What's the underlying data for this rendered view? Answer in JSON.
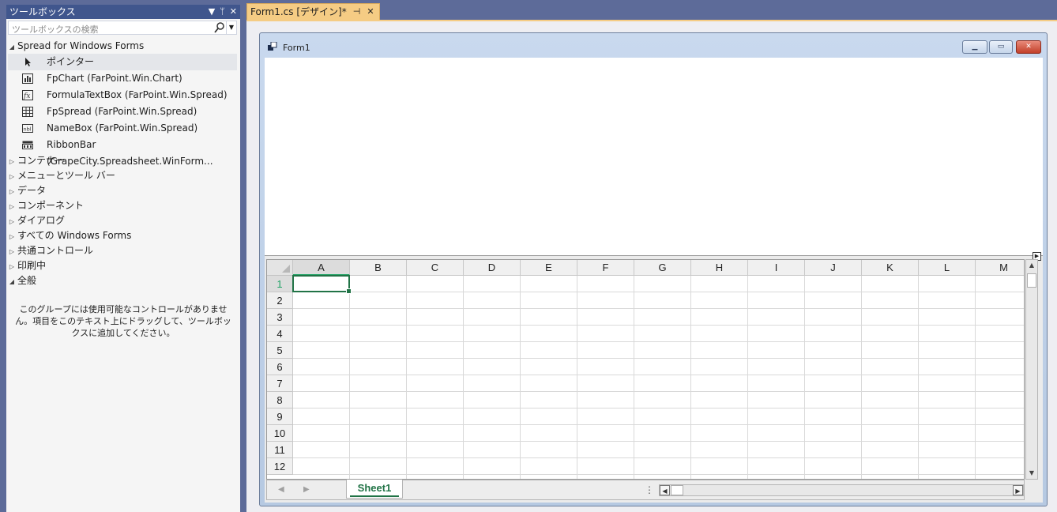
{
  "toolbox": {
    "title": "ツールボックス",
    "buttons": {
      "dropdown": "▼",
      "pin": "ᛘ",
      "close": "✕"
    },
    "search_placeholder": "ツールボックスの検索",
    "groups": [
      {
        "label": "Spread for Windows Forms",
        "expanded": true
      },
      {
        "label": "コンテナー",
        "expanded": false
      },
      {
        "label": "メニューとツール バー",
        "expanded": false
      },
      {
        "label": "データ",
        "expanded": false
      },
      {
        "label": "コンポーネント",
        "expanded": false
      },
      {
        "label": "ダイアログ",
        "expanded": false
      },
      {
        "label": "すべての Windows Forms",
        "expanded": false
      },
      {
        "label": "共通コントロール",
        "expanded": false
      },
      {
        "label": "印刷中",
        "expanded": false
      },
      {
        "label": "全般",
        "expanded": true
      }
    ],
    "items": [
      {
        "label": "ポインター",
        "icon": "pointer-icon",
        "selected": true
      },
      {
        "label": "FpChart (FarPoint.Win.Chart)",
        "icon": "chart-icon"
      },
      {
        "label": "FormulaTextBox (FarPoint.Win.Spread)",
        "icon": "formula-icon"
      },
      {
        "label": "FpSpread (FarPoint.Win.Spread)",
        "icon": "grid-icon"
      },
      {
        "label": "NameBox (FarPoint.Win.Spread)",
        "icon": "namebox-icon"
      },
      {
        "label": "RibbonBar (GrapeCity.Spreadsheet.WinForm...",
        "icon": "ribbon-icon"
      }
    ],
    "empty_message": "このグループには使用可能なコントロールがありません。項目をこのテキスト上にドラッグして、ツールボックスに追加してください。"
  },
  "document_tab": {
    "label": "Form1.cs [デザイン]*",
    "pin": "⊣",
    "close": "✕"
  },
  "form": {
    "title": "Form1",
    "buttons": {
      "minimize": "▁",
      "maximize": "▭",
      "close": "✕"
    }
  },
  "spread": {
    "columns": [
      "A",
      "B",
      "C",
      "D",
      "E",
      "F",
      "G",
      "H",
      "I",
      "J",
      "K",
      "L",
      "M"
    ],
    "rows": [
      "1",
      "2",
      "3",
      "4",
      "5",
      "6",
      "7",
      "8",
      "9",
      "10",
      "11",
      "12"
    ],
    "active_cell": "A1",
    "sheet_tab": "Sheet1",
    "nav": {
      "prev": "◀",
      "next": "▶"
    },
    "splitter": "⋮",
    "scroll": {
      "up": "▲",
      "down": "▼",
      "left": "◀",
      "right": "▶"
    }
  },
  "colors": {
    "accent": "#217346",
    "tab_active": "#f5cc84",
    "chrome": "#5d6b99"
  }
}
